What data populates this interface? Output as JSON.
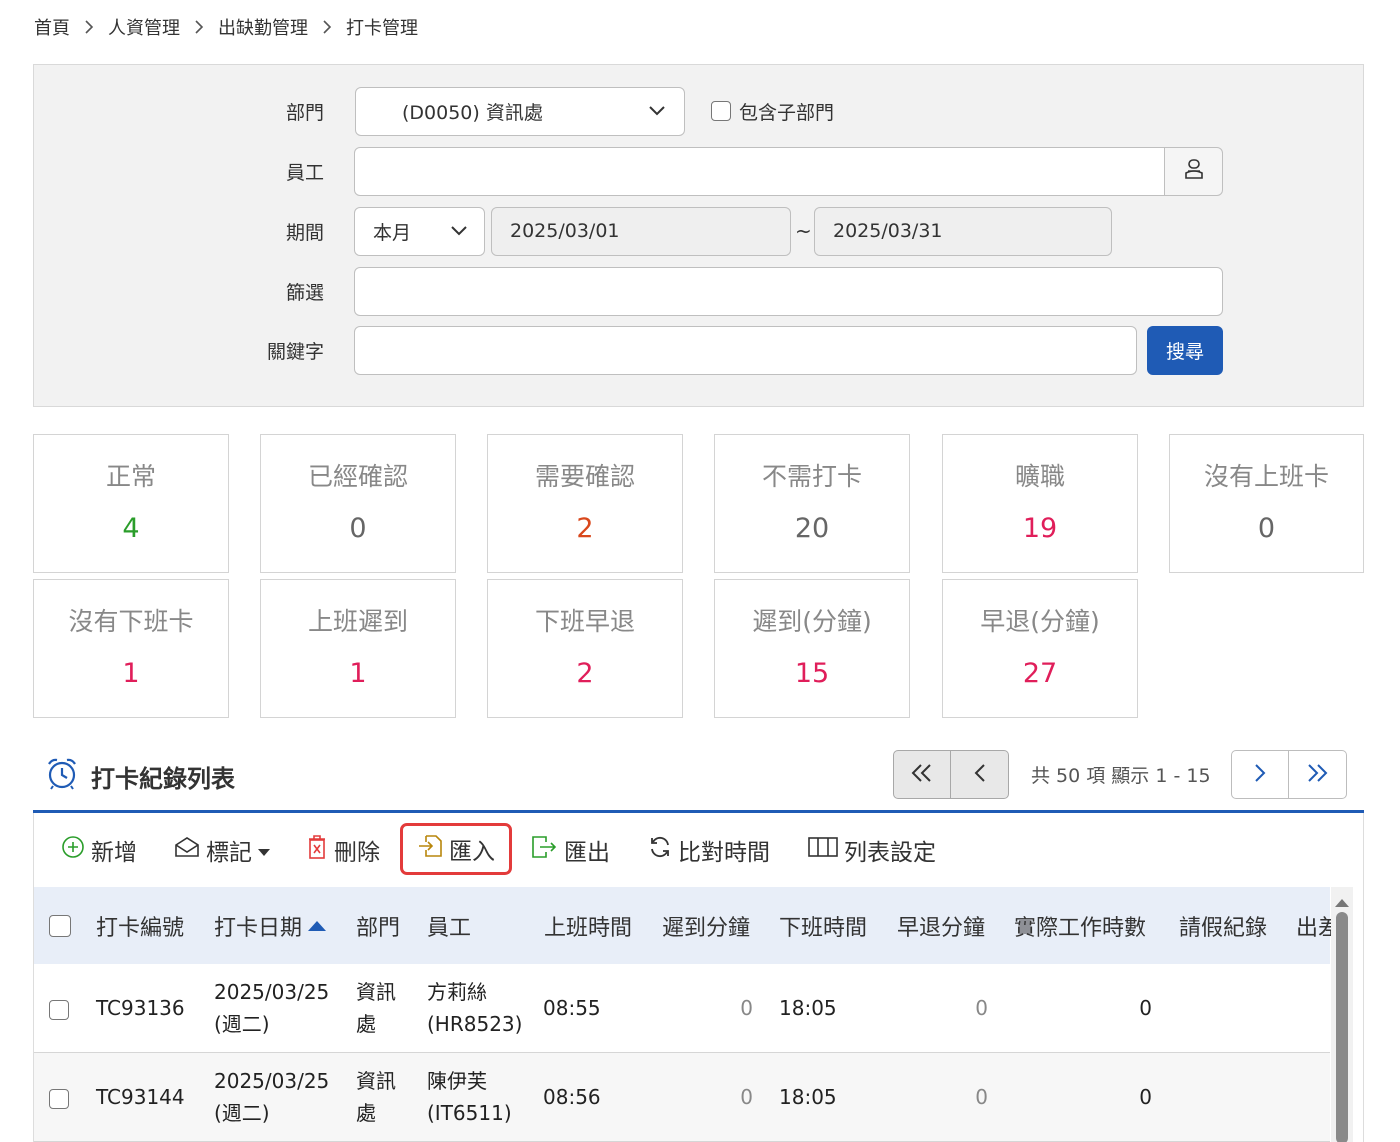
{
  "breadcrumb": [
    "首頁",
    "人資管理",
    "出缺勤管理",
    "打卡管理"
  ],
  "filter": {
    "dept_label": "部門",
    "dept_value": "(D0050) 資訊處",
    "include_sub_label": "包含子部門",
    "employee_label": "員工",
    "employee_value": "",
    "period_label": "期間",
    "period_preset": "本月",
    "date_from": "2025/03/01",
    "date_sep": "~",
    "date_to": "2025/03/31",
    "screen_label": "篩選",
    "keyword_label": "關鍵字",
    "search_button": "搜尋"
  },
  "stats": [
    {
      "label": "正常",
      "value": "4",
      "color": "#2a9d2a"
    },
    {
      "label": "已經確認",
      "value": "0",
      "color": "#666666"
    },
    {
      "label": "需要確認",
      "value": "2",
      "color": "#d9481c"
    },
    {
      "label": "不需打卡",
      "value": "20",
      "color": "#666666"
    },
    {
      "label": "曠職",
      "value": "19",
      "color": "#e01e5a"
    },
    {
      "label": "沒有上班卡",
      "value": "0",
      "color": "#666666"
    },
    {
      "label": "沒有下班卡",
      "value": "1",
      "color": "#e01e5a"
    },
    {
      "label": "上班遲到",
      "value": "1",
      "color": "#e01e5a"
    },
    {
      "label": "下班早退",
      "value": "2",
      "color": "#e01e5a"
    },
    {
      "label": "遲到(分鐘)",
      "value": "15",
      "color": "#e01e5a"
    },
    {
      "label": "早退(分鐘)",
      "value": "27",
      "color": "#e01e5a"
    }
  ],
  "list": {
    "title": "打卡紀錄列表",
    "pager_info": "共 50 項 顯示 1 - 15"
  },
  "toolbar": {
    "add": "新增",
    "mark": "標記",
    "delete": "刪除",
    "import": "匯入",
    "export": "匯出",
    "compare": "比對時間",
    "columns": "列表設定"
  },
  "table": {
    "headers": [
      "打卡編號",
      "打卡日期",
      "部門",
      "員工",
      "上班時間",
      "遲到分鐘",
      "下班時間",
      "早退分鐘",
      "實際工作時數",
      "請假紀錄",
      "出差"
    ],
    "rows": [
      {
        "id": "TC93136",
        "date": "2025/03/25",
        "weekday": "(週二)",
        "dept1": "資訊",
        "dept2": "處",
        "emp_name": "方莉絲",
        "emp_code": "(HR8523)",
        "in": "08:55",
        "late": "0",
        "out": "18:05",
        "early": "0",
        "hours": "0"
      },
      {
        "id": "TC93144",
        "date": "2025/03/25",
        "weekday": "(週二)",
        "dept1": "資訊",
        "dept2": "處",
        "emp_name": "陳伊芙",
        "emp_code": "(IT6511)",
        "in": "08:56",
        "late": "0",
        "out": "18:05",
        "early": "0",
        "hours": "0"
      }
    ]
  },
  "colors": {
    "primary": "#1f5bb5",
    "highlight": "#e33b3b",
    "header_bg": "#e8eef8"
  }
}
